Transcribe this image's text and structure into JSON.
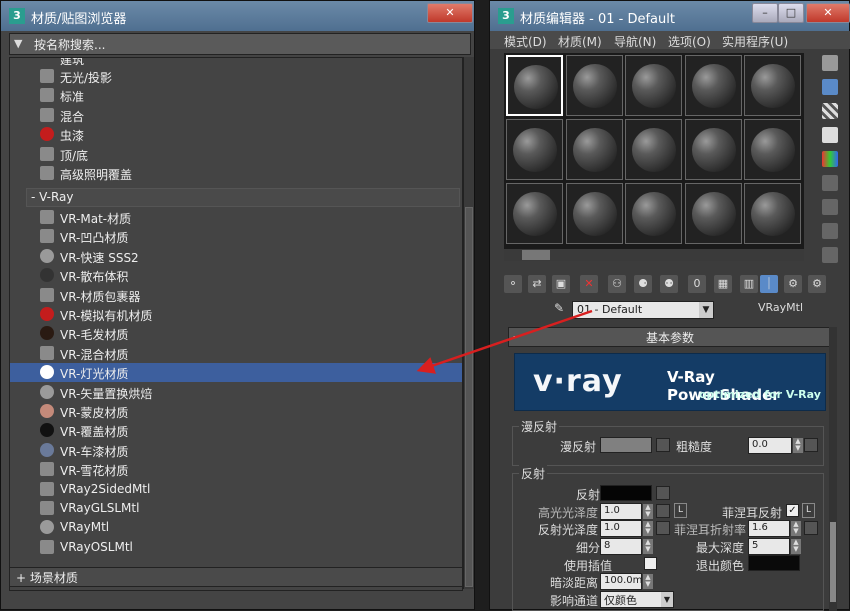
{
  "browser": {
    "title": "材质/贴图浏览器",
    "search_placeholder": "按名称搜索...",
    "partial_row": "建筑",
    "standard_items": [
      {
        "label": "无光/投影",
        "swatch": "#8a8a8a"
      },
      {
        "label": "标准",
        "swatch": "#8a8a8a"
      },
      {
        "label": "混合",
        "swatch": "#8a8a8a"
      },
      {
        "label": "虫漆",
        "swatch": "#c41d1d"
      },
      {
        "label": "顶/底",
        "swatch": "#8a8a8a"
      },
      {
        "label": "高级照明覆盖",
        "swatch": "#8a8a8a"
      }
    ],
    "vray_group": "- V-Ray",
    "vray_items": [
      {
        "label": "VR-Mat-材质",
        "swatch": "#8a8a8a"
      },
      {
        "label": "VR-凹凸材质",
        "swatch": "#8a8a8a"
      },
      {
        "label": "VR-快速 SSS2",
        "swatch": "#9a9a9a"
      },
      {
        "label": "VR-散布体积",
        "swatch": "#333333"
      },
      {
        "label": "VR-材质包裹器",
        "swatch": "#8a8a8a"
      },
      {
        "label": "VR-模拟有机材质",
        "swatch": "#c41d1d"
      },
      {
        "label": "VR-毛发材质",
        "swatch": "#2a1a12"
      },
      {
        "label": "VR-混合材质",
        "swatch": "#8a8a8a"
      },
      {
        "label": "VR-灯光材质",
        "swatch": "#ffffff"
      },
      {
        "label": "VR-矢量置换烘焙",
        "swatch": "#9a9a9a"
      },
      {
        "label": "VR-蒙皮材质",
        "swatch": "#c48a7a"
      },
      {
        "label": "VR-覆盖材质",
        "swatch": "#111111"
      },
      {
        "label": "VR-车漆材质",
        "swatch": "#6a7a9a"
      },
      {
        "label": "VR-雪花材质",
        "swatch": "#8a8a8a"
      },
      {
        "label": "VRay2SidedMtl",
        "swatch": "#8a8a8a"
      },
      {
        "label": "VRayGLSLMtl",
        "swatch": "#8a8a8a"
      },
      {
        "label": "VRayMtl",
        "swatch": "#9a9a9a"
      },
      {
        "label": "VRayOSLMtl",
        "swatch": "#8a8a8a"
      }
    ],
    "selected_label": "VR-灯光材质",
    "scene_group": "+ 场景材质"
  },
  "editor": {
    "title": "材质编辑器 - 01 - Default",
    "menu": [
      "模式(D)",
      "材质(M)",
      "导航(N)",
      "选项(O)",
      "实用程序(U)"
    ],
    "material_name": "01 - Default",
    "material_type": "VRayMtl",
    "rollout_title": "基本参数",
    "banner_logo": "v·ray",
    "banner_title": "V-Ray PowerShader",
    "banner_subtitle": "optimized for V-Ray",
    "diffuse_section": "漫反射",
    "diffuse_label": "漫反射",
    "roughness_label": "粗糙度",
    "roughness_value": "0.0",
    "reflect_section": "反射",
    "reflect_label": "反射",
    "hilight_gloss_label": "高光光泽度",
    "hilight_gloss_value": "1.0",
    "l_btn": "L",
    "fresnel_label": "菲涅耳反射",
    "refl_gloss_label": "反射光泽度",
    "refl_gloss_value": "1.0",
    "fresnel_ior_label": "菲涅耳折射率",
    "fresnel_ior_value": "1.6",
    "subdivs_label": "细分",
    "subdivs_value": "8",
    "max_depth_label": "最大深度",
    "max_depth_value": "5",
    "use_interp_label": "使用插值",
    "exit_color_label": "退出颜色",
    "dim_distance_label": "暗淡距离",
    "dim_distance_value": "100.0m",
    "affect_channels_label": "影响通道",
    "affect_channels_value": "仅颜色"
  },
  "colors": {
    "selection": "#3d5f9e",
    "arrow": "#d81f1f",
    "banner": "#143c66"
  }
}
